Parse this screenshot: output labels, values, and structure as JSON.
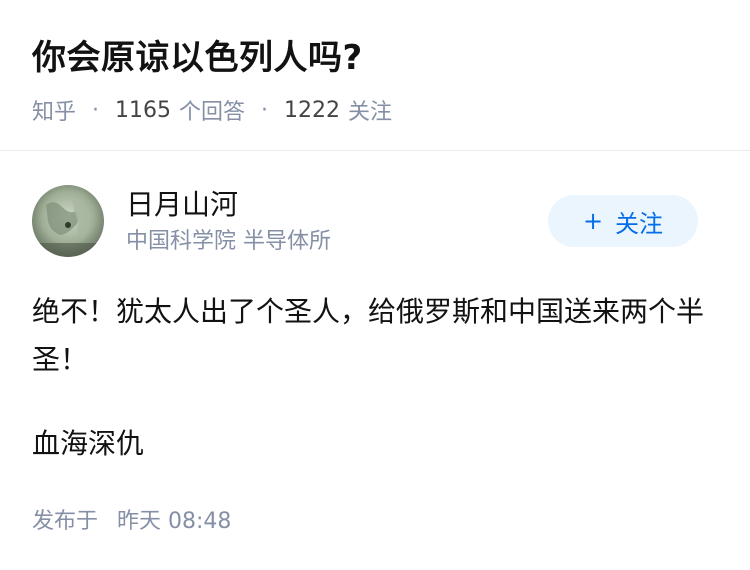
{
  "question": {
    "title": "你会原谅以色列人吗?",
    "source": "知乎",
    "separator": "·",
    "answer_count": "1165",
    "answer_label": "个回答",
    "follower_count": "1222",
    "follower_label": "关注"
  },
  "answer": {
    "author_name": "日月山河",
    "author_org": "中国科学院 半导体所",
    "follow_button": {
      "plus": "+",
      "label": "关注"
    },
    "paragraphs": [
      "绝不！犹太人出了个圣人，给俄罗斯和中国送来两个半圣！",
      "血海深仇"
    ],
    "posted_label": "发布于",
    "posted_time": "昨天 08:48"
  },
  "colors": {
    "meta": "#8590a6",
    "accent": "#056de8",
    "button_bg": "#ebf5fd"
  },
  "icons": {
    "avatar": "author-avatar-image"
  }
}
